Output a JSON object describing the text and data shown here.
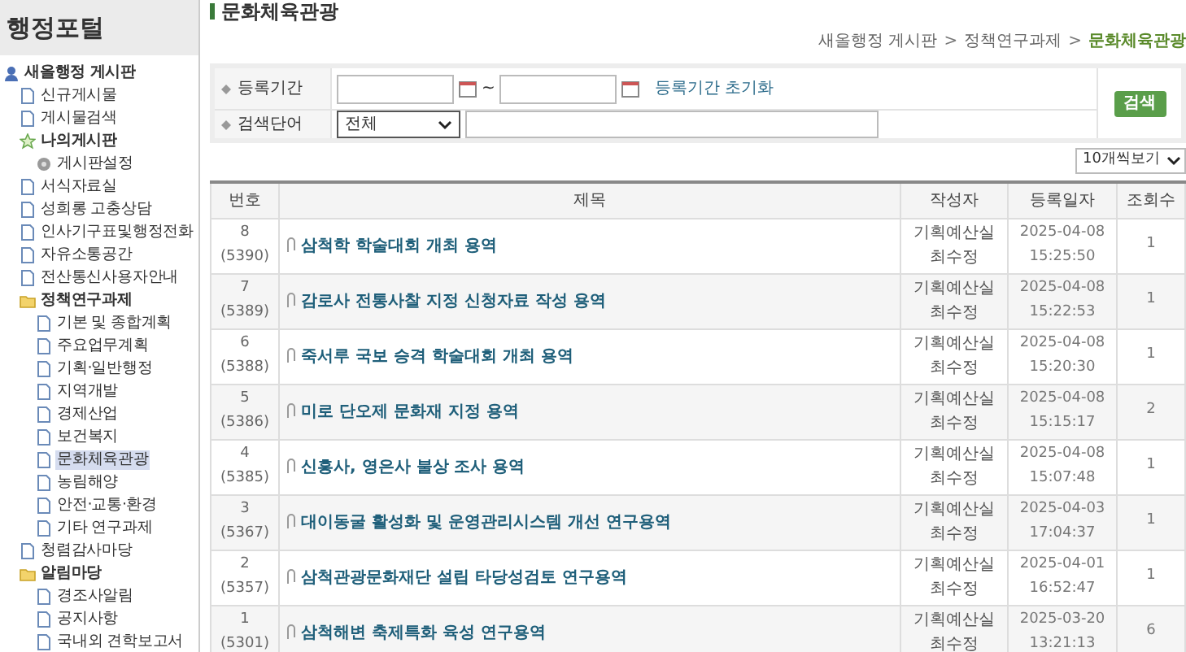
{
  "sidebar": {
    "title": "행정포털",
    "tree": [
      {
        "label": "새올행정 게시판",
        "kind": "board",
        "selected": false,
        "children": [
          {
            "label": "신규게시물",
            "kind": "page",
            "selected": false
          },
          {
            "label": "게시물검색",
            "kind": "page",
            "selected": false
          },
          {
            "label": "나의게시판",
            "kind": "star",
            "selected": false,
            "children": [
              {
                "label": "게시판설정",
                "kind": "gear",
                "selected": false
              }
            ]
          },
          {
            "label": "서식자료실",
            "kind": "page",
            "selected": false
          },
          {
            "label": "성희롱 고충상담",
            "kind": "page",
            "selected": false
          },
          {
            "label": "인사기구표및행정전화",
            "kind": "page",
            "selected": false
          },
          {
            "label": "자유소통공간",
            "kind": "page",
            "selected": false
          },
          {
            "label": "전산통신사용자안내",
            "kind": "page",
            "selected": false
          },
          {
            "label": "정책연구과제",
            "kind": "folder",
            "selected": false,
            "children": [
              {
                "label": "기본 및 종합계획",
                "kind": "page",
                "selected": false
              },
              {
                "label": "주요업무계획",
                "kind": "page",
                "selected": false
              },
              {
                "label": "기획·일반행정",
                "kind": "page",
                "selected": false
              },
              {
                "label": "지역개발",
                "kind": "page",
                "selected": false
              },
              {
                "label": "경제산업",
                "kind": "page",
                "selected": false
              },
              {
                "label": "보건복지",
                "kind": "page",
                "selected": false
              },
              {
                "label": "문화체육관광",
                "kind": "page",
                "selected": true
              },
              {
                "label": "농림해양",
                "kind": "page",
                "selected": false
              },
              {
                "label": "안전·교통·환경",
                "kind": "page",
                "selected": false
              },
              {
                "label": "기타 연구과제",
                "kind": "page",
                "selected": false
              }
            ]
          },
          {
            "label": "청렴감사마당",
            "kind": "page",
            "selected": false
          },
          {
            "label": "알림마당",
            "kind": "folder",
            "selected": false,
            "children": [
              {
                "label": "경조사알림",
                "kind": "page",
                "selected": false
              },
              {
                "label": "공지사항",
                "kind": "page",
                "selected": false
              },
              {
                "label": "국내외 견학보고서",
                "kind": "page",
                "selected": false
              }
            ]
          }
        ]
      }
    ]
  },
  "page_title": "문화체육관광",
  "breadcrumb": [
    "새올행정 게시판",
    "정책연구과제",
    "문화체육관광"
  ],
  "breadcrumb_separator": ">",
  "search": {
    "period_label": "등록기간",
    "range_separator": "~",
    "reset_link": "등록기간 초기화",
    "keyword_label": "검색단어",
    "scope": "전체",
    "button": "검색"
  },
  "page_size": "10개씩보기",
  "table": {
    "columns": [
      "번호",
      "제목",
      "작성자",
      "등록일자",
      "조회수"
    ],
    "rows": [
      {
        "number": "8",
        "post_no": "(5390)",
        "title": "삼척학 학술대회 개최 용역",
        "department": "기획예산실",
        "author": "최수정",
        "date": "2025-04-08",
        "time": "15:25:50",
        "views": "1"
      },
      {
        "number": "7",
        "post_no": "(5389)",
        "title": "감로사 전통사찰 지정 신청자료 작성 용역",
        "department": "기획예산실",
        "author": "최수정",
        "date": "2025-04-08",
        "time": "15:22:53",
        "views": "1"
      },
      {
        "number": "6",
        "post_no": "(5388)",
        "title": "죽서루 국보 승격 학술대회 개최 용역",
        "department": "기획예산실",
        "author": "최수정",
        "date": "2025-04-08",
        "time": "15:20:30",
        "views": "1"
      },
      {
        "number": "5",
        "post_no": "(5386)",
        "title": "미로 단오제 문화재 지정 용역",
        "department": "기획예산실",
        "author": "최수정",
        "date": "2025-04-08",
        "time": "15:15:17",
        "views": "2"
      },
      {
        "number": "4",
        "post_no": "(5385)",
        "title": "신흥사, 영은사 불상 조사 용역",
        "department": "기획예산실",
        "author": "최수정",
        "date": "2025-04-08",
        "time": "15:07:48",
        "views": "1"
      },
      {
        "number": "3",
        "post_no": "(5367)",
        "title": "대이동굴 활성화 및 운영관리시스템 개선 연구용역",
        "department": "기획예산실",
        "author": "최수정",
        "date": "2025-04-03",
        "time": "17:04:37",
        "views": "1"
      },
      {
        "number": "2",
        "post_no": "(5357)",
        "title": "삼척관광문화재단 설립 타당성검토 연구용역",
        "department": "기획예산실",
        "author": "최수정",
        "date": "2025-04-01",
        "time": "16:52:47",
        "views": "1"
      },
      {
        "number": "1",
        "post_no": "(5301)",
        "title": "삼척해변 축제특화 육성 연구용역",
        "department": "기획예산실",
        "author": "최수정",
        "date": "2025-03-20",
        "time": "13:21:13",
        "views": "6"
      }
    ]
  }
}
